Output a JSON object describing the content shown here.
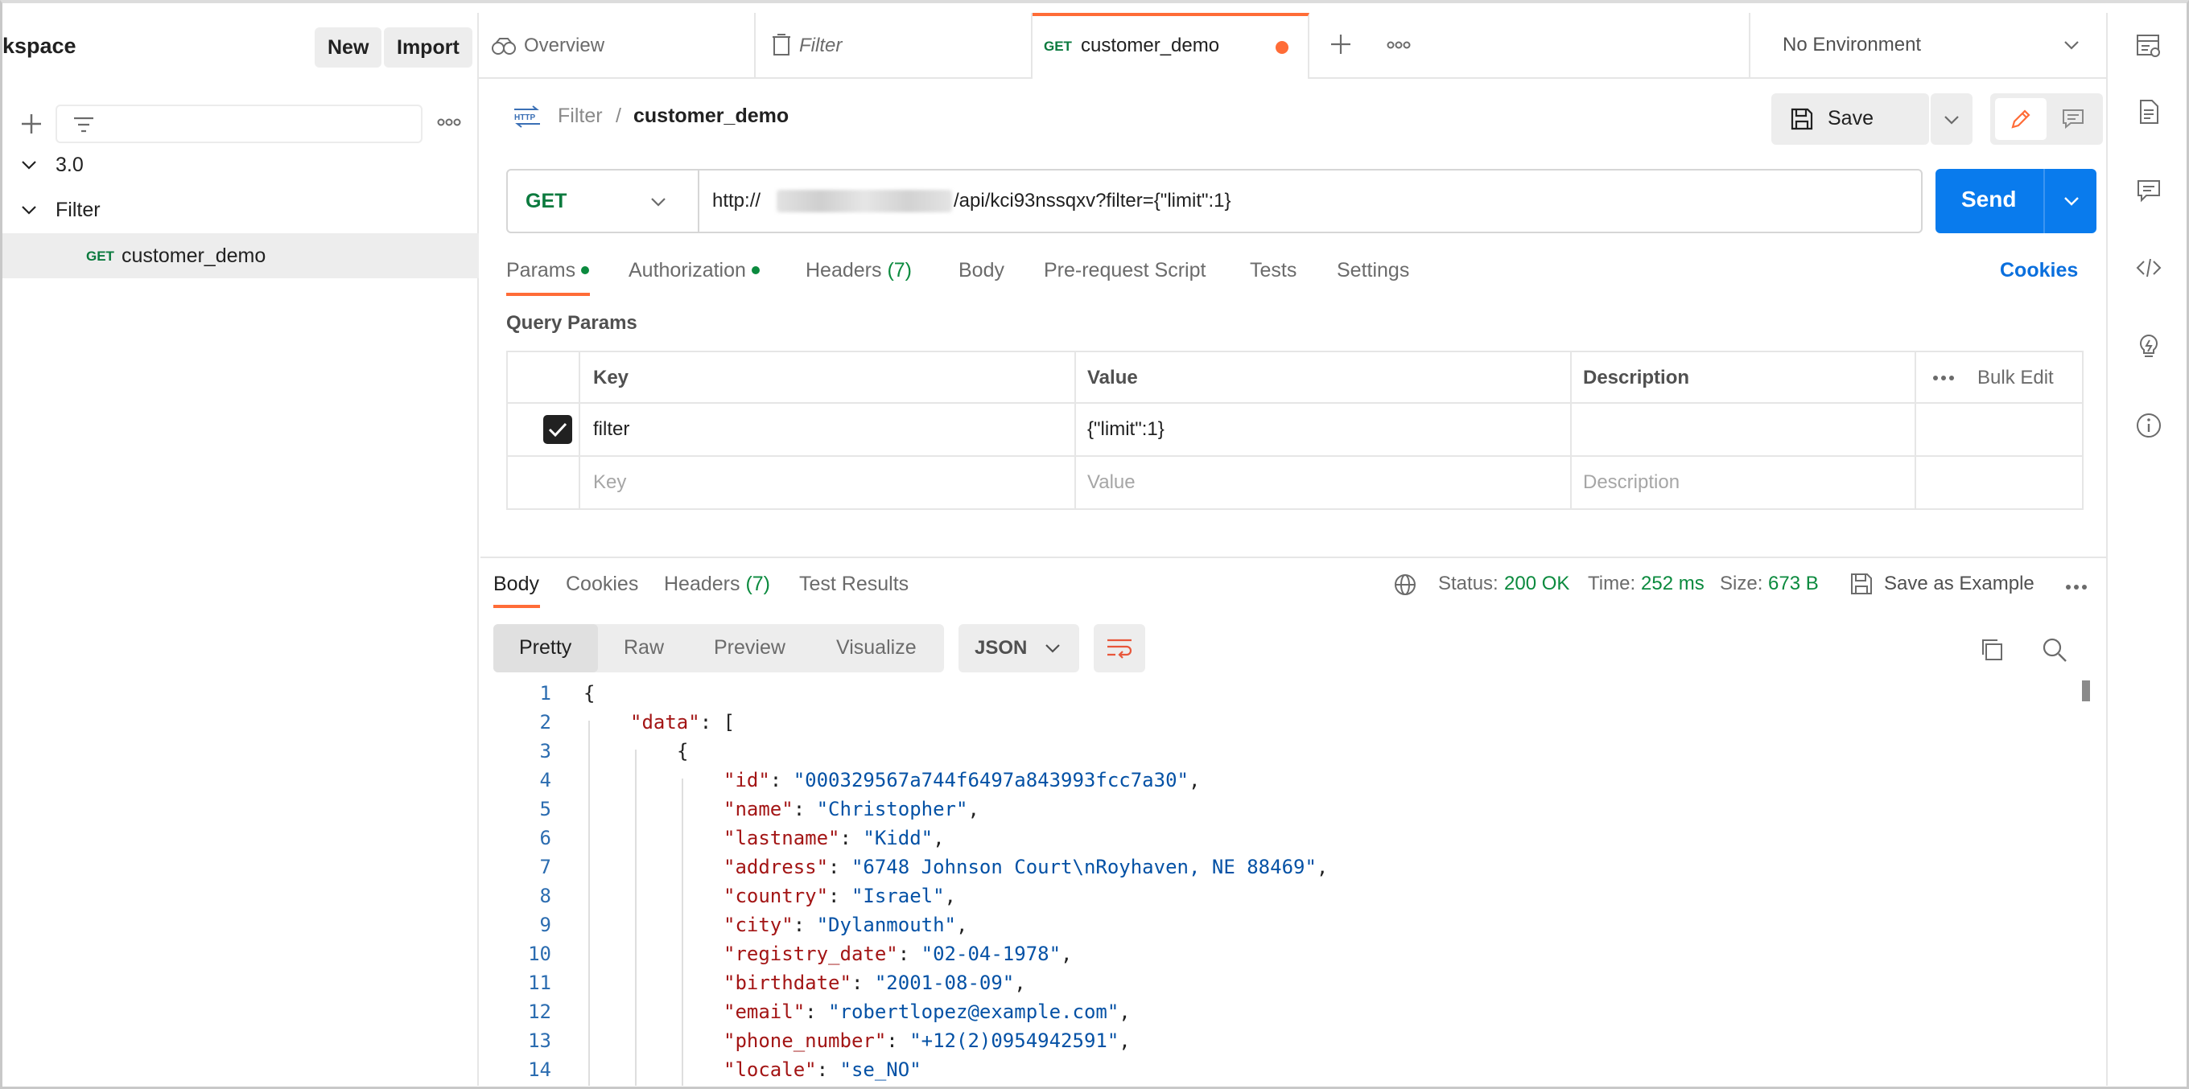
{
  "sidebar": {
    "workspace_title": "kspace",
    "new_label": "New",
    "import_label": "Import",
    "tree": [
      {
        "label": "3.0"
      },
      {
        "label": "Filter"
      },
      {
        "method": "GET",
        "label": "customer_demo"
      }
    ]
  },
  "tabs": [
    {
      "label": "Overview"
    },
    {
      "label": "Filter"
    },
    {
      "method": "GET",
      "label": "customer_demo"
    }
  ],
  "environment": {
    "label": "No Environment"
  },
  "request": {
    "breadcrumb_parent": "Filter",
    "breadcrumb_sep": "/",
    "breadcrumb_current": "customer_demo",
    "http_badge": "HTTP",
    "save_label": "Save",
    "method": "GET",
    "url_prefix": "http://",
    "url_suffix": "/api/kci93nssqxv?filter={\"limit\":1}",
    "send_label": "Send",
    "tabs": [
      {
        "label": "Params",
        "dot": true
      },
      {
        "label": "Authorization",
        "dot": true
      },
      {
        "label": "Headers",
        "count": "(7)"
      },
      {
        "label": "Body"
      },
      {
        "label": "Pre-request Script"
      },
      {
        "label": "Tests"
      },
      {
        "label": "Settings"
      }
    ],
    "cookies_label": "Cookies",
    "query_params_title": "Query Params",
    "table": {
      "headers": {
        "key": "Key",
        "value": "Value",
        "description": "Description",
        "bulk_edit": "Bulk Edit"
      },
      "rows": [
        {
          "key": "filter",
          "value": "{\"limit\":1}",
          "checked": true
        }
      ],
      "placeholders": {
        "key": "Key",
        "value": "Value",
        "description": "Description"
      }
    }
  },
  "response": {
    "tabs": [
      {
        "label": "Body"
      },
      {
        "label": "Cookies"
      },
      {
        "label": "Headers",
        "count": "(7)"
      },
      {
        "label": "Test Results"
      }
    ],
    "status_label": "Status:",
    "status_value": "200 OK",
    "time_label": "Time:",
    "time_value": "252 ms",
    "size_label": "Size:",
    "size_value": "673 B",
    "save_example_label": "Save as Example",
    "views": [
      "Pretty",
      "Raw",
      "Preview",
      "Visualize"
    ],
    "format": "JSON",
    "code_lines": [
      {
        "n": "1",
        "indent": 0,
        "text": "{"
      },
      {
        "n": "2",
        "indent": 1,
        "key": "\"data\"",
        "rest": ": ["
      },
      {
        "n": "3",
        "indent": 2,
        "text": "{"
      },
      {
        "n": "4",
        "indent": 3,
        "key": "\"id\"",
        "val": "\"000329567a744f6497a843993fcc7a30\"",
        "tail": ","
      },
      {
        "n": "5",
        "indent": 3,
        "key": "\"name\"",
        "val": "\"Christopher\"",
        "tail": ","
      },
      {
        "n": "6",
        "indent": 3,
        "key": "\"lastname\"",
        "val": "\"Kidd\"",
        "tail": ","
      },
      {
        "n": "7",
        "indent": 3,
        "key": "\"address\"",
        "val": "\"6748 Johnson Court\\nRoyhaven, NE 88469\"",
        "tail": ","
      },
      {
        "n": "8",
        "indent": 3,
        "key": "\"country\"",
        "val": "\"Israel\"",
        "tail": ","
      },
      {
        "n": "9",
        "indent": 3,
        "key": "\"city\"",
        "val": "\"Dylanmouth\"",
        "tail": ","
      },
      {
        "n": "10",
        "indent": 3,
        "key": "\"registry_date\"",
        "val": "\"02-04-1978\"",
        "tail": ","
      },
      {
        "n": "11",
        "indent": 3,
        "key": "\"birthdate\"",
        "val": "\"2001-08-09\"",
        "tail": ","
      },
      {
        "n": "12",
        "indent": 3,
        "key": "\"email\"",
        "val": "\"robertlopez@example.com\"",
        "tail": ","
      },
      {
        "n": "13",
        "indent": 3,
        "key": "\"phone_number\"",
        "val": "\"+12(2)0954942591\"",
        "tail": ","
      },
      {
        "n": "14",
        "indent": 3,
        "key": "\"locale\"",
        "val": "\"se_NO\"",
        "tail": ""
      }
    ]
  },
  "colors": {
    "accent": "#ff6c37",
    "send": "#097bed",
    "get_method": "#0b7a3e",
    "success": "#0b8a3e",
    "json_key": "#a31515",
    "json_string": "#0451a5"
  }
}
